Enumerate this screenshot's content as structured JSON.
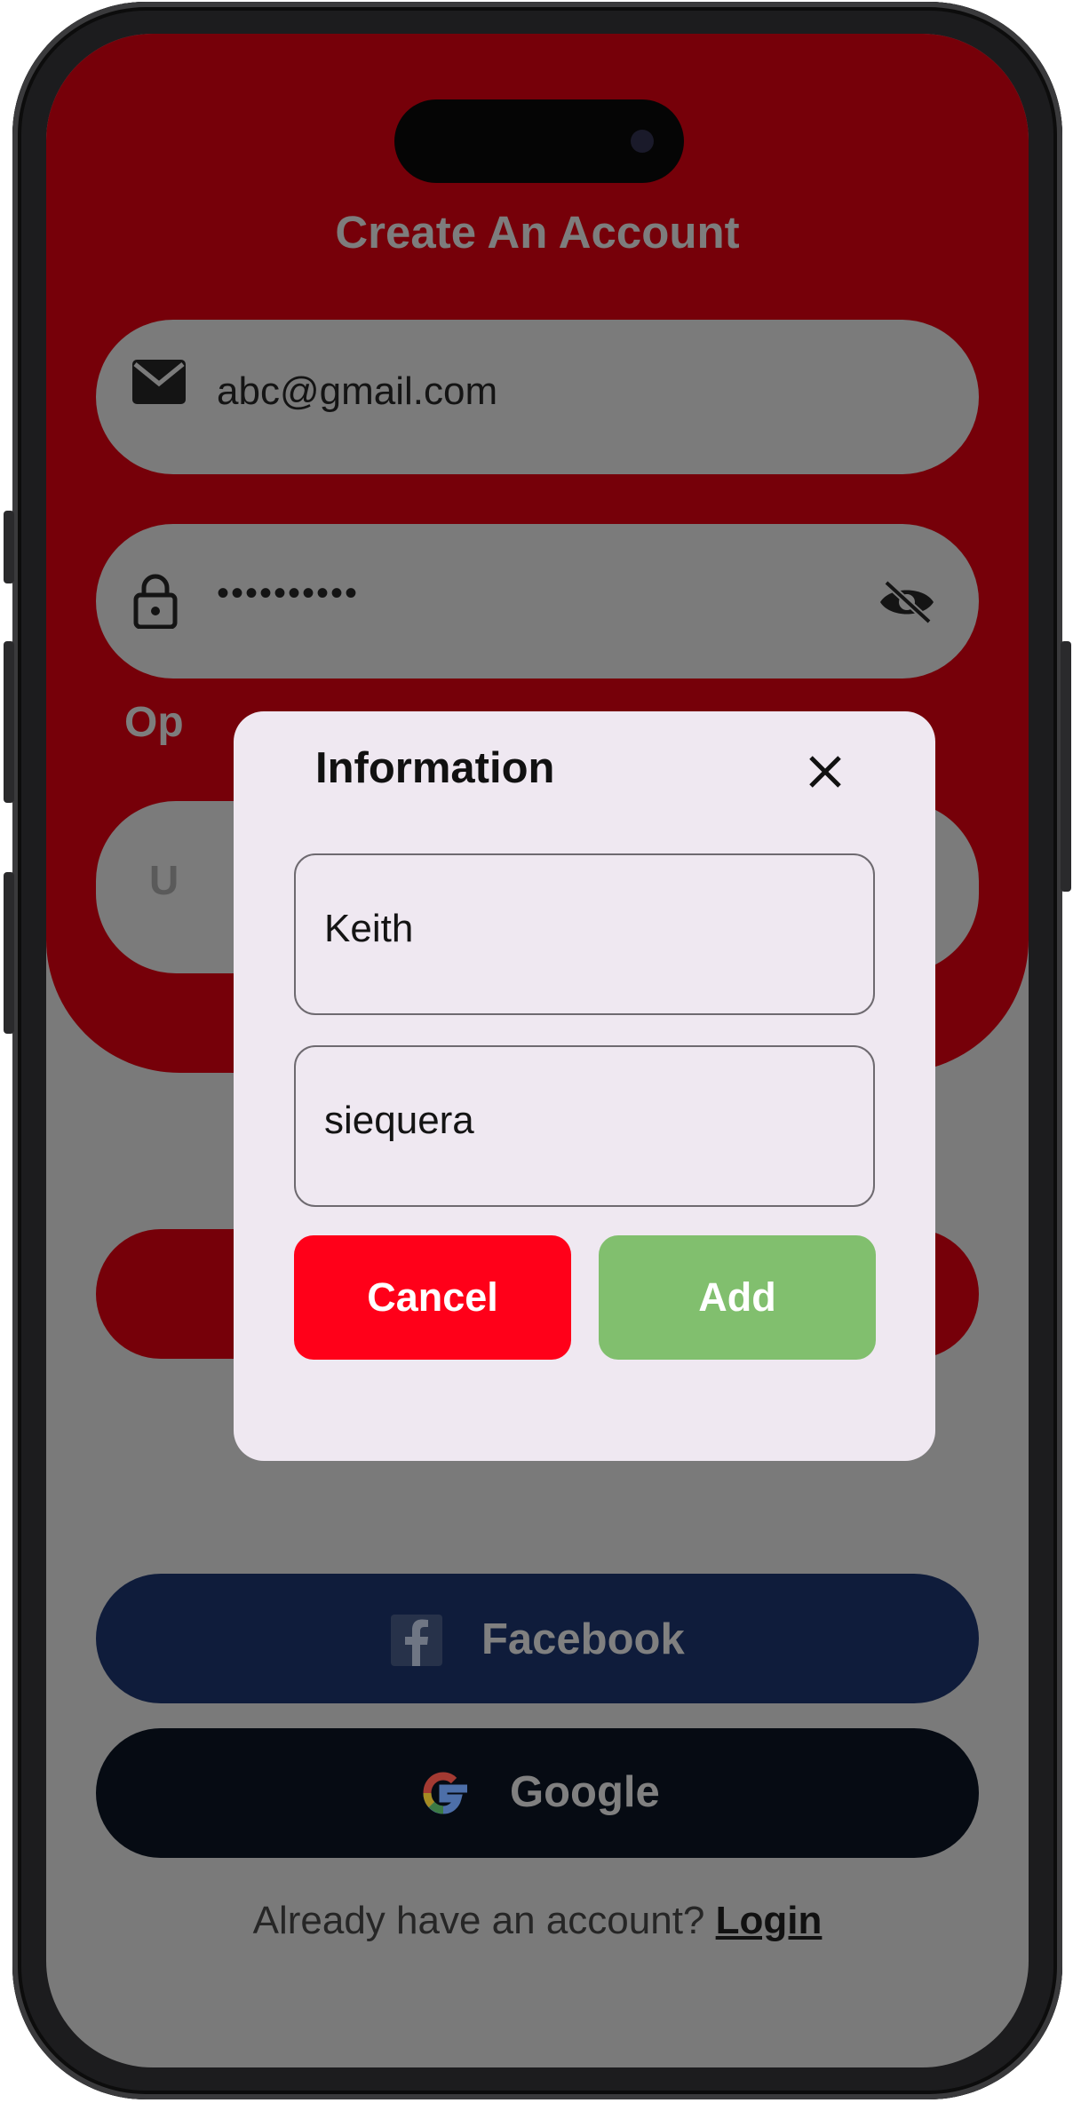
{
  "signup": {
    "title": "Create An Account",
    "email_value": "abc@gmail.com",
    "password_value": "••••••••••",
    "options_label_partial": "Op",
    "username_partial": "U"
  },
  "social": {
    "facebook_label": "Facebook",
    "google_label": "Google"
  },
  "footer": {
    "prompt": "Already have an account?",
    "login_link": "Login"
  },
  "dialog": {
    "title": "Information",
    "first_field_value": "Keith",
    "second_field_value": "siequera",
    "cancel_label": "Cancel",
    "add_label": "Add"
  },
  "colors": {
    "brand_red": "#760009",
    "cancel_red": "#ff0019",
    "add_green": "#81bf6e",
    "facebook_navy": "#0f1c3b",
    "google_black": "#060b13",
    "overlay_gray": "#7a7a7a"
  },
  "icons": [
    "mail-icon",
    "lock-icon",
    "eye-off-icon",
    "close-icon",
    "facebook-icon",
    "google-icon"
  ]
}
